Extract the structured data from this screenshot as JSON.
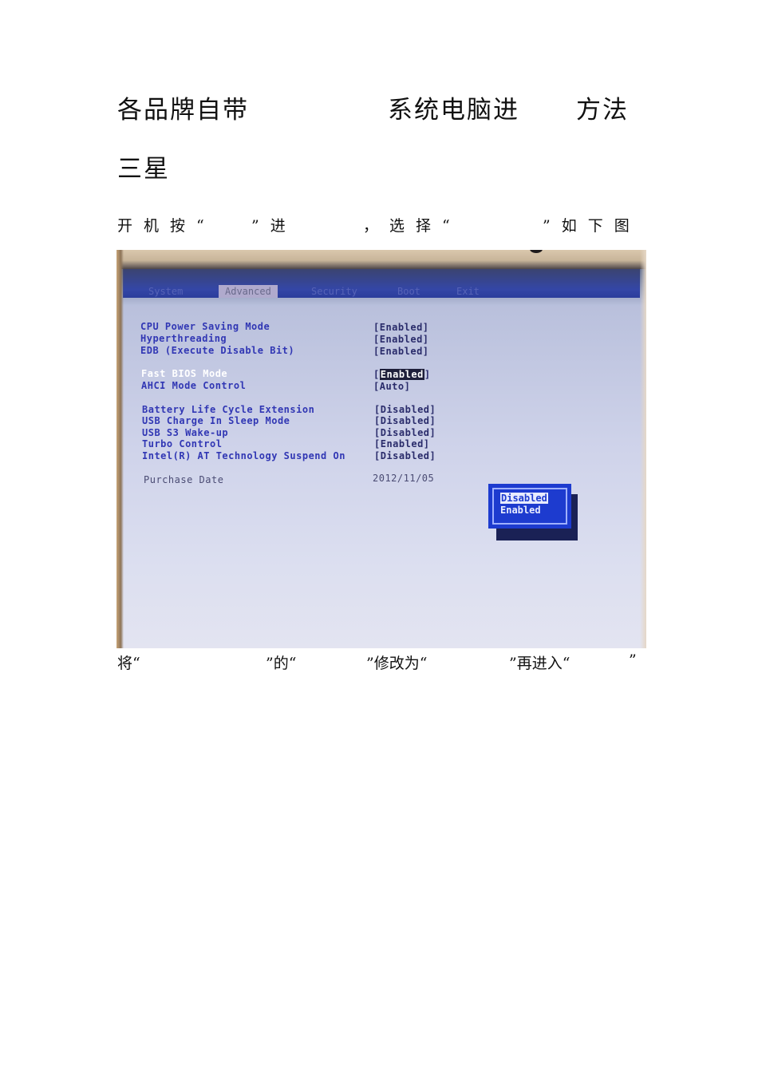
{
  "heading": {
    "part1": "各品牌自带",
    "part2": "系统电脑进",
    "part3": "方法"
  },
  "brand": "三星",
  "line1": {
    "a": "开机按“",
    "b": "”进",
    "c": "，选择“",
    "d": "”如下图"
  },
  "line2": {
    "a": "将“",
    "b": "”的“",
    "c": "”修改为“",
    "d": "”再进入“",
    "e": "”"
  },
  "bios": {
    "tabs": [
      "System",
      "Advanced",
      "Security",
      "Boot",
      "Exit"
    ],
    "active_tab": "Advanced",
    "settings": [
      {
        "label": "CPU Power Saving Mode",
        "value": "[Enabled]"
      },
      {
        "label": "Hyperthreading",
        "value": "[Enabled]"
      },
      {
        "label": "EDB (Execute Disable Bit)",
        "value": "[Enabled]"
      },
      {
        "label": "Fast BIOS Mode",
        "value": "Enabled"
      },
      {
        "label": "AHCI Mode Control",
        "value": "[Auto]"
      },
      {
        "label": "Battery Life Cycle Extension",
        "value": "[Disabled]"
      },
      {
        "label": "USB Charge In Sleep Mode",
        "value": "[Disabled]"
      },
      {
        "label": "USB S3 Wake-up",
        "value": "[Disabled]"
      },
      {
        "label": "Turbo Control",
        "value": "[Enabled]"
      },
      {
        "label": "Intel(R) AT Technology Suspend On",
        "value": "[Disabled]"
      },
      {
        "label": "Purchase Date",
        "value": "2012/11/05"
      }
    ],
    "popup_options": [
      "Disabled",
      "Enabled"
    ],
    "popup_selected": "Disabled",
    "colors": {
      "text_blue": "#3137b4",
      "header_blue": "#3446a6",
      "popup_blue": "#1d3bcf"
    }
  }
}
